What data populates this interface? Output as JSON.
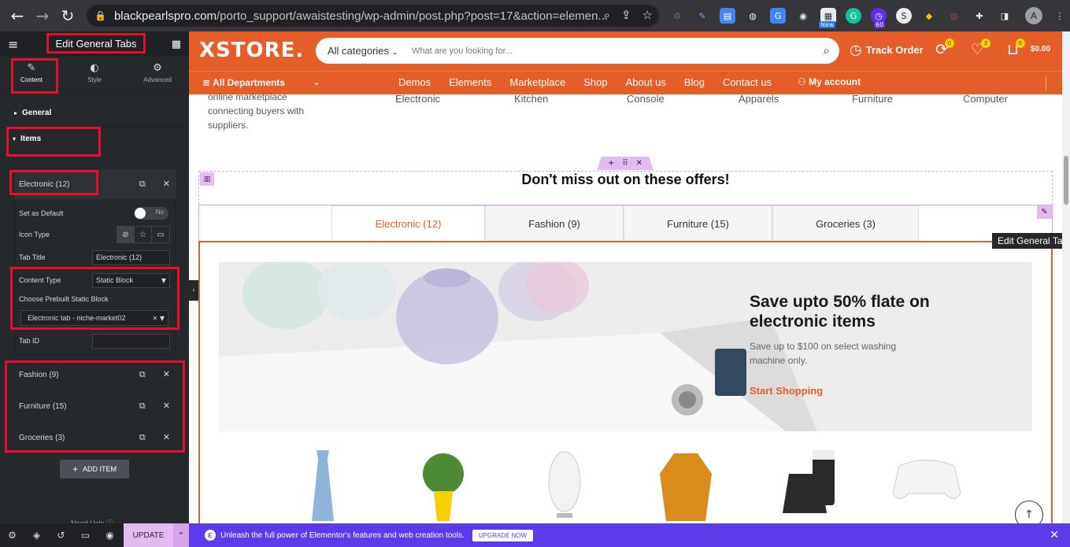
{
  "browser": {
    "url_host": "blackpearlspro.com",
    "url_path": "/porto_support/awaistesting/wp-admin/post.php?post=17&action=elemen...",
    "ext_badge_new": "New",
    "ext_badge_count": "60",
    "profile_initial": "A"
  },
  "panel": {
    "title": "Edit General Tabs",
    "tabs": [
      {
        "label": "Content"
      },
      {
        "label": "Style"
      },
      {
        "label": "Advanced"
      }
    ],
    "section_general": "General",
    "section_items": "Items",
    "items": [
      {
        "label": "Electronic (12)"
      },
      {
        "label": "Fashion (9)"
      },
      {
        "label": "Furniture (15)"
      },
      {
        "label": "Groceries (3)"
      }
    ],
    "controls": {
      "set_default_label": "Set as Default",
      "toggle_text": "No",
      "icon_type_label": "Icon Type",
      "tab_title_label": "Tab Title",
      "tab_title_value": "Electronic (12)",
      "content_type_label": "Content Type",
      "content_type_value": "Static Block",
      "prebuilt_label": "Choose Prebuilt Static Block",
      "prebuilt_value": "Electronic tab - niche-market02",
      "tab_id_label": "Tab ID",
      "tab_id_value": ""
    },
    "add_item": "ADD ITEM",
    "need_help": "Need Help",
    "update": "UPDATE"
  },
  "site": {
    "logo": "XSTORE.",
    "search_category": "All categories",
    "search_placeholder": "What are you looking for...",
    "track_order": "Track Order",
    "notify_count": "0",
    "wishlist_count": "2",
    "cart_count": "0",
    "cart_total": "$0.00",
    "all_departments": "All Departments",
    "menu": [
      "Demos",
      "Elements",
      "Marketplace",
      "Shop",
      "About us",
      "Blog",
      "Contact us"
    ],
    "my_account": "My account",
    "intro_text": "online marketplace connecting buyers with suppliers.",
    "categories": [
      "Electronic",
      "Kitchen",
      "Console",
      "Apparels",
      "Furniture",
      "Computer"
    ],
    "offers_title": "Don't miss out on these offers!",
    "tabs": [
      "Electronic (12)",
      "Fashion (9)",
      "Furniture (15)",
      "Groceries (3)"
    ],
    "tooltip": "Edit General Tabs",
    "banner": {
      "heading": "Save upto 50% flate on electronic items",
      "text": "Save up to $100 on select washing machine only.",
      "cta": "Start Shopping"
    }
  },
  "promo": {
    "text": "Unleash the full power of Elementor's features and web creation tools.",
    "button": "UPGRADE NOW"
  },
  "colors": {
    "brand_orange": "#e55d29",
    "elementor_pink": "#e2bcf0",
    "promo_purple": "#5b3bea",
    "annotation_red": "#e0102e"
  }
}
